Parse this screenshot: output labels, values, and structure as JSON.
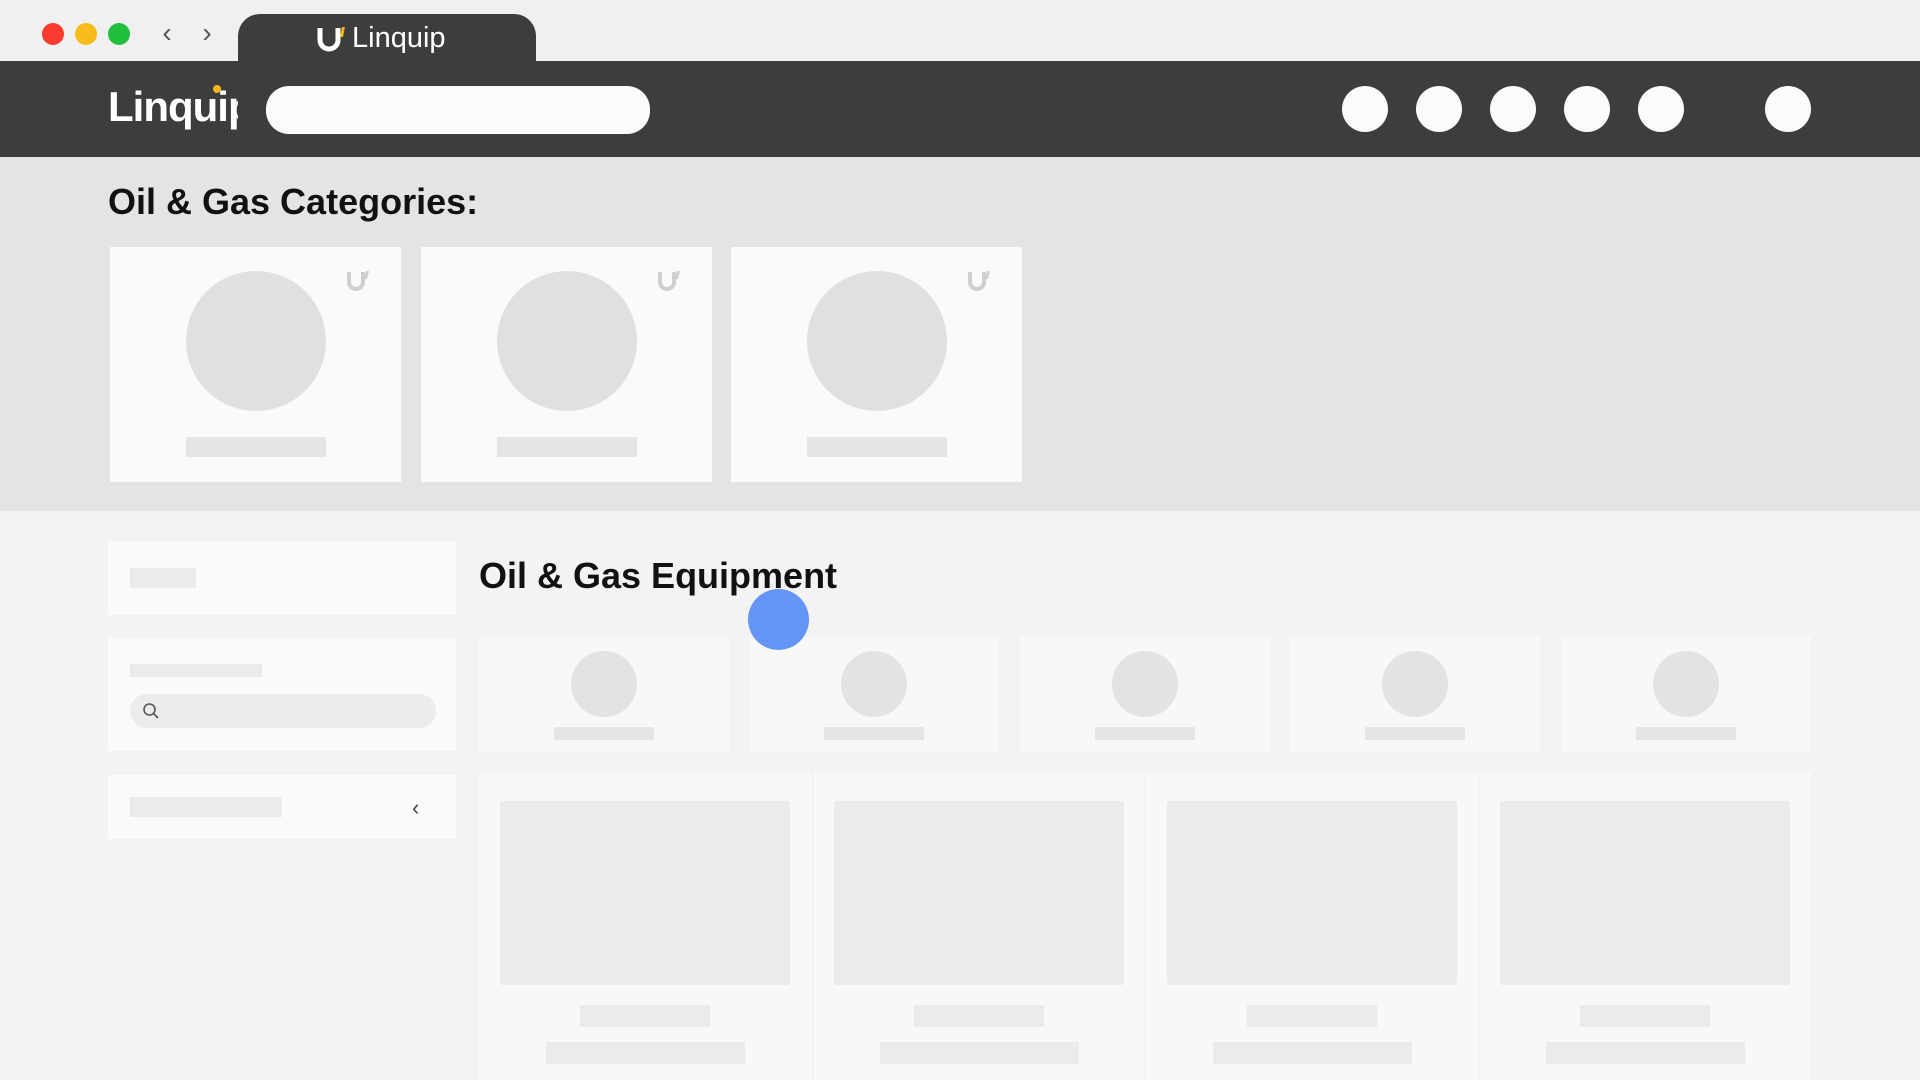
{
  "browser": {
    "tab_title": "Linquip",
    "back_icon": "chevron-left-icon",
    "forward_icon": "chevron-right-icon"
  },
  "header": {
    "brand": "Linquip",
    "search_placeholder": "",
    "icons": [
      "circle-icon",
      "circle-icon",
      "circle-icon",
      "circle-icon",
      "circle-icon",
      "avatar-icon"
    ]
  },
  "categories": {
    "title": "Oil & Gas Categories:",
    "card_count": 3
  },
  "equipment": {
    "title": "Oil & Gas Equipment",
    "card_count": 5
  },
  "filters": {
    "search_placeholder": ""
  },
  "products": {
    "count": 4
  },
  "colors": {
    "header_bg": "#3d3d3d",
    "brand_accent": "#f4b51b",
    "cursor_marker": "#5d8ff3"
  }
}
